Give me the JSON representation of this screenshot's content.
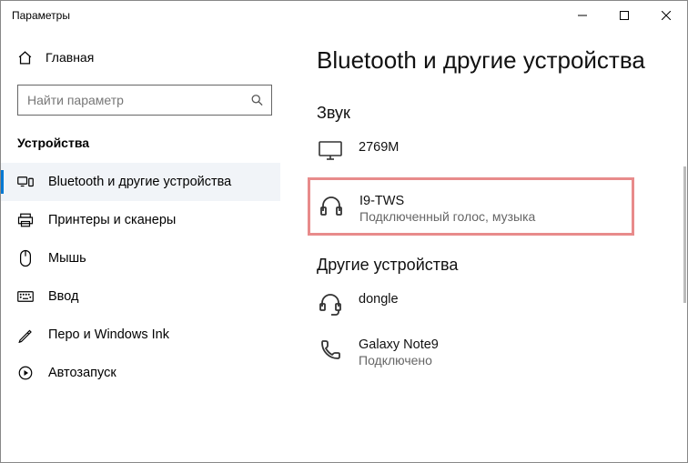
{
  "window": {
    "title": "Параметры"
  },
  "home": {
    "label": "Главная"
  },
  "search": {
    "placeholder": "Найти параметр"
  },
  "sidebar": {
    "section": "Устройства",
    "items": [
      {
        "label": "Bluetooth и другие устройства"
      },
      {
        "label": "Принтеры и сканеры"
      },
      {
        "label": "Мышь"
      },
      {
        "label": "Ввод"
      },
      {
        "label": "Перо и Windows Ink"
      },
      {
        "label": "Автозапуск"
      }
    ]
  },
  "main": {
    "heading": "Bluetooth и другие устройства",
    "groups": {
      "sound": {
        "title": "Звук",
        "devices": [
          {
            "name": "2769M",
            "status": ""
          },
          {
            "name": "I9-TWS",
            "status": "Подключенный голос, музыка"
          }
        ]
      },
      "other": {
        "title": "Другие устройства",
        "devices": [
          {
            "name": "dongle",
            "status": ""
          },
          {
            "name": "Galaxy Note9",
            "status": "Подключено"
          }
        ]
      }
    }
  }
}
